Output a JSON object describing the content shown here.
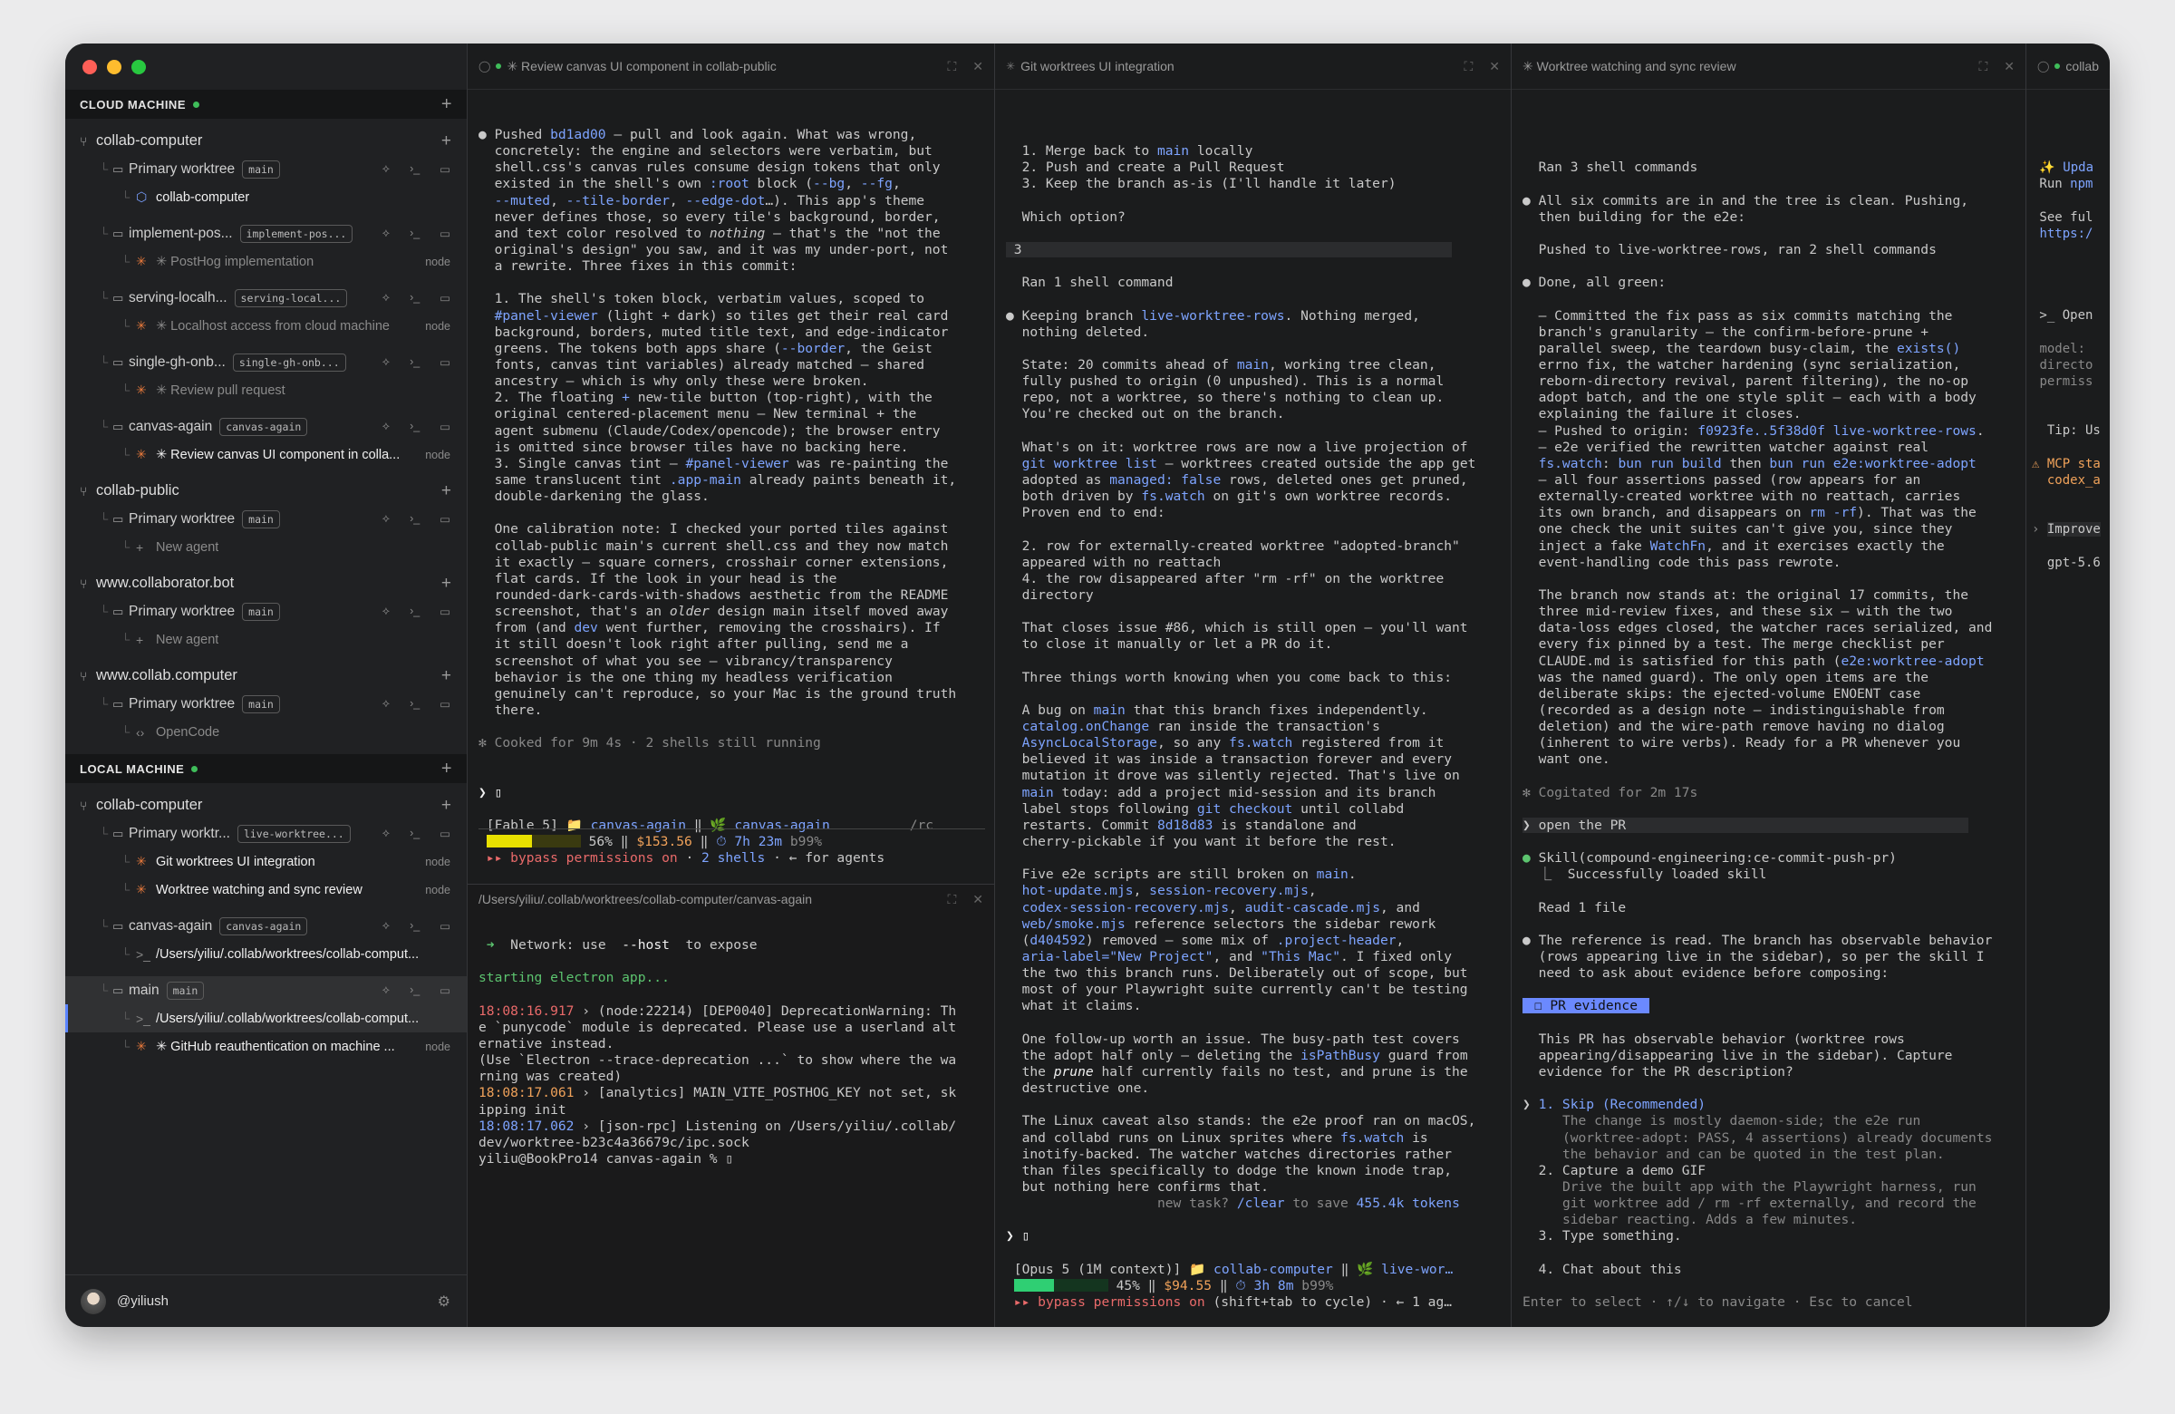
{
  "sidebar": {
    "cloud_header": "CLOUD MACHINE",
    "local_header": "LOCAL MACHINE",
    "user": "@yiliush",
    "cloud": [
      {
        "repo": "collab-computer",
        "worktrees": [
          {
            "name": "Primary worktree",
            "branch": "main",
            "items": [
              {
                "icon": "hex",
                "text": "collab-computer",
                "tone": "bright"
              }
            ]
          },
          {
            "name": "implement-pos...",
            "branch": "implement-pos...",
            "items": [
              {
                "icon": "star",
                "text": "✳ PostHog implementation",
                "tone": "dim",
                "node": "node"
              }
            ]
          },
          {
            "name": "serving-localh...",
            "branch": "serving-local...",
            "items": [
              {
                "icon": "star",
                "text": "✳ Localhost access from cloud machine",
                "tone": "dim",
                "node": "node"
              }
            ]
          },
          {
            "name": "single-gh-onb...",
            "branch": "single-gh-onb...",
            "items": [
              {
                "icon": "star",
                "text": "✳ Review pull request",
                "tone": "dim"
              }
            ]
          },
          {
            "name": "canvas-again",
            "branch": "canvas-again",
            "items": [
              {
                "icon": "star",
                "text": "✳ Review canvas UI component in colla...",
                "tone": "bright",
                "node": "node"
              }
            ]
          }
        ]
      },
      {
        "repo": "collab-public",
        "worktrees": [
          {
            "name": "Primary worktree",
            "branch": "main",
            "items": [
              {
                "icon": "plus",
                "text": "New agent",
                "tone": "dim"
              }
            ]
          }
        ]
      },
      {
        "repo": "www.collaborator.bot",
        "worktrees": [
          {
            "name": "Primary worktree",
            "branch": "main",
            "items": [
              {
                "icon": "plus",
                "text": "New agent",
                "tone": "dim"
              }
            ]
          }
        ]
      },
      {
        "repo": "www.collab.computer",
        "worktrees": [
          {
            "name": "Primary worktree",
            "branch": "main",
            "items": [
              {
                "icon": "code",
                "text": "OpenCode",
                "tone": "dim"
              }
            ]
          }
        ]
      }
    ],
    "local": [
      {
        "repo": "collab-computer",
        "worktrees": [
          {
            "name": "Primary worktr...",
            "branch": "live-worktree...",
            "items": [
              {
                "icon": "star",
                "text": "Git worktrees UI integration",
                "tone": "bright",
                "node": "node"
              },
              {
                "icon": "star",
                "text": "Worktree watching and sync review",
                "tone": "bright",
                "node": "node"
              }
            ]
          },
          {
            "name": "canvas-again",
            "branch": "canvas-again",
            "items": [
              {
                "icon": "term",
                "text": "/Users/yiliu/.collab/worktrees/collab-comput...",
                "tone": "bright"
              }
            ]
          },
          {
            "name": "main",
            "branch": "main",
            "active": true,
            "items": [
              {
                "icon": "term",
                "text": "/Users/yiliu/.collab/worktrees/collab-comput...",
                "tone": "bright",
                "active": true
              },
              {
                "icon": "star",
                "text": "✳ GitHub reauthentication on machine ...",
                "tone": "bright",
                "node": "node"
              }
            ]
          }
        ]
      }
    ]
  },
  "panes": {
    "p1": {
      "title": "✳ Review canvas UI component in collab-public",
      "lines": [
        "● Pushed <span class=\"hl\">bd1ad00</span> — pull and look again. What was wrong,",
        "  concretely: the engine and selectors were verbatim, but",
        "  shell.css's canvas rules consume design tokens that only",
        "  existed in the shell's own <span class=\"hl\">:root</span> block (<span class=\"hl\">--bg</span>, <span class=\"hl\">--fg</span>,",
        "  <span class=\"hl\">--muted</span>, <span class=\"hl\">--tile-border</span>, <span class=\"hl\">--edge-dot</span>…). This app's theme",
        "  never defines those, so every tile's background, border,",
        "  and text color resolved to <i>nothing</i> — that's the \"not the",
        "  original's design\" you saw, and it was my under-port, not",
        "  a rewrite. Three fixes in this commit:",
        "",
        "  1. The shell's token block, verbatim values, scoped to",
        "  <span class=\"hl\">#panel-viewer</span> (light + dark) so tiles get their real card",
        "  background, borders, muted title text, and edge-indicator",
        "  greens. The tokens both apps share (<span class=\"hl\">--border</span>, the Geist",
        "  fonts, canvas tint variables) already matched — shared",
        "  ancestry — which is why only these were broken.",
        "  2. The floating <span class=\"hl\">+</span> new-tile button (top-right), with the",
        "  original centered-placement menu — New terminal + the",
        "  agent submenu (Claude/Codex/opencode); the browser entry",
        "  is omitted since browser tiles have no backing here.",
        "  3. Single canvas tint — <span class=\"hl\">#panel-viewer</span> was re-painting the",
        "  same translucent tint <span class=\"hl\">.app-main</span> already paints beneath it,",
        "  double-darkening the glass.",
        "",
        "  One calibration note: I checked your ported tiles against",
        "  collab-public main's current shell.css and they now match",
        "  it exactly — square corners, crosshair corner extensions,",
        "  flat cards. If the look in your head is the",
        "  rounded-dark-cards-with-shadows aesthetic from the README",
        "  screenshot, that's an <i>older</i> design main itself moved away",
        "  from (and <span class=\"hl\">dev</span> went further, removing the crosshairs). If",
        "  it still doesn't look right after pulling, send me a",
        "  screenshot of what you see — vibrancy/transparency",
        "  behavior is the one thing my headless verification",
        "  genuinely can't reproduce, so your Mac is the ground truth",
        "  there.",
        "",
        "<span class=\"dim\">✻ Cooked for 9m 4s · 2 shells still running</span>",
        "",
        "",
        "<span class=\"wh\">❯ ▯</span>",
        "",
        " [Fable 5] 📁 <span class=\"hl\">canvas-again</span> ‖ 🌿 <span class=\"hl\">canvas-again</span>          <span class=\"dim\">/rc</span>",
        " <span class=\"bar\" style=\"width:50px;background:#e8e000\"></span><span class=\"bar\" style=\"width:54px;background:#3a3a10\"></span> 56% ‖ <span class=\"or\">$153.56</span> ‖ <span class=\"hl\">⏱ 7h 23m</span> <span class=\"dim\">b99%</span>",
        " <span class=\"rd\">▸▸ bypass permissions on</span> · <span class=\"hl\">2 shells</span> · ← for agents"
      ]
    },
    "p1term": {
      "title": "/Users/yiliu/.collab/worktrees/collab-computer/canvas-again",
      "lines": [
        "",
        " <span class=\"gr\">➜</span>  Network: use  <span class=\"wh\">--host</span>  to expose",
        "",
        "<span class=\"gr\">starting electron app...</span>",
        "",
        "<span class=\"rd\">18:08:16.917</span> › (node:22214) [DEP0040] DeprecationWarning: Th",
        "e `punycode` module is deprecated. Please use a userland alt",
        "ernative instead.",
        "(Use `Electron --trace-deprecation ...` to show where the wa",
        "rning was created)",
        "<span class=\"or\">18:08:17.061</span> › [analytics] MAIN_VITE_POSTHOG_KEY not set, sk",
        "ipping init",
        "<span class=\"hl\">18:08:17.062</span> › [json-rpc] Listening on /Users/yiliu/.collab/",
        "dev/worktree-b23c4a36679c/ipc.sock",
        "yiliu@BookPro14 canvas-again % ▯"
      ]
    },
    "p2": {
      "title": "Git worktrees UI integration",
      "lines": [
        "",
        "  1. Merge back to <span class=\"hl\">main</span> locally",
        "  2. Push and create a Pull Request",
        "  3. Keep the branch as-is (I'll handle it later)",
        "",
        "  Which option?",
        "",
        "<span class=\"choice\"> 3                                                      </span>",
        "",
        "  Ran 1 shell command",
        "",
        "● Keeping branch <span class=\"hl\">live-worktree-rows</span>. Nothing merged,",
        "  nothing deleted.",
        "",
        "  State: 20 commits ahead of <span class=\"hl\">main</span>, working tree clean,",
        "  fully pushed to origin (0 unpushed). This is a normal",
        "  repo, not a worktree, so there's nothing to clean up.",
        "  You're checked out on the branch.",
        "",
        "  What's on it: worktree rows are now a live projection of",
        "  <span class=\"hl\">git worktree list</span> — worktrees created outside the app get",
        "  adopted as <span class=\"hl\">managed: false</span> rows, deleted ones get pruned,",
        "  both driven by <span class=\"hl\">fs.watch</span> on git's own worktree records.",
        "  Proven end to end:",
        "",
        "  2. row for externally-created worktree \"adopted-branch\"",
        "  appeared with no reattach",
        "  4. the row disappeared after \"rm -rf\" on the worktree",
        "  directory",
        "",
        "  That closes issue #86, which is still open — you'll want",
        "  to close it manually or let a PR do it.",
        "",
        "  Three things worth knowing when you come back to this:",
        "",
        "  A bug on <span class=\"hl\">main</span> that this branch fixes independently.",
        "  <span class=\"hl\">catalog.onChange</span> ran inside the transaction's",
        "  <span class=\"hl\">AsyncLocalStorage</span>, so any <span class=\"hl\">fs.watch</span> registered from it",
        "  believed it was inside a transaction forever and every",
        "  mutation it drove was silently rejected. That's live on",
        "  <span class=\"hl\">main</span> today: add a project mid-session and its branch",
        "  label stops following <span class=\"hl\">git checkout</span> until collabd",
        "  restarts. Commit <span class=\"hl\">8d18d83</span> is standalone and",
        "  cherry-pickable if you want it before the rest.",
        "",
        "  Five e2e scripts are still broken on <span class=\"hl\">main</span>.",
        "  <span class=\"hl\">hot-update.mjs</span>, <span class=\"hl\">session-recovery.mjs</span>,",
        "  <span class=\"hl\">codex-session-recovery.mjs</span>, <span class=\"hl\">audit-cascade.mjs</span>, and",
        "  <span class=\"hl\">web/smoke.mjs</span> reference selectors the sidebar rework",
        "  (<span class=\"hl\">d404592</span>) removed — some mix of <span class=\"hl\">.project-header</span>,",
        "  <span class=\"hl\">aria-label=\"New Project\"</span>, and <span class=\"hl\">\"This Mac\"</span>. I fixed only",
        "  the two this branch runs. Deliberately out of scope, but",
        "  most of your Playwright suite currently can't be testing",
        "  what it claims.",
        "",
        "  One follow-up worth an issue. The busy-path test covers",
        "  the adopt half only — deleting the <span class=\"hl\">isPathBusy</span> guard from",
        "  the <i class=\"wh\">prune</i> half currently fails no test, and prune is the",
        "  destructive one.",
        "",
        "  The Linux caveat also stands: the e2e proof ran on macOS,",
        "  and collabd runs on Linux sprites where <span class=\"hl\">fs.watch</span> is",
        "  inotify-backed. The watcher watches directories rather",
        "  than files specifically to dodge the known inode trap,",
        "  but nothing here confirms that.",
        "                   <span class=\"dim\">new task?</span> <span class=\"hl\">/clear</span> <span class=\"dim\">to save</span> <span class=\"hl\">455.4k tokens</span>",
        "",
        "<span class=\"wh\">❯ ▯</span>",
        "",
        " [Opus 5 (1M context)] 📁 <span class=\"hl\">collab-computer</span> ‖ 🌿 <span class=\"hl\">live-wor…</span>",
        " <span class=\"bar\" style=\"width:44px;background:#2fcf73\"></span><span class=\"bar\" style=\"width:60px;background:#14351f\"></span> 45% ‖ <span class=\"or\">$94.55</span> ‖ <span class=\"hl\">⏱ 3h 8m</span> <span class=\"dim\">b99%</span>",
        " <span class=\"rd\">▸▸ bypass permissions on</span> (shift+tab to cycle) · ← 1 ag…"
      ]
    },
    "p3": {
      "title": "✳ Worktree watching and sync review",
      "lines": [
        "",
        "",
        "  Ran 3 shell commands",
        "",
        "● All six commits are in and the tree is clean. Pushing,",
        "  then building for the e2e:",
        "",
        "  Pushed to live-worktree-rows, ran 2 shell commands",
        "",
        "● Done, all green:",
        "",
        "  – Committed the fix pass as six commits matching the",
        "  branch's granularity — the confirm-before-prune +",
        "  parallel sweep, the teardown busy-claim, the <span class=\"hl\">exists()</span>",
        "  errno fix, the watcher hardening (sync serialization,",
        "  reborn-directory revival, parent filtering), the no-op",
        "  adopt batch, and the one style split — each with a body",
        "  explaining the failure it closes.",
        "  – Pushed to origin: <span class=\"hl\">f0923fe..5f38d0f live-worktree-rows</span>.",
        "  – e2e verified the rewritten watcher against real",
        "  <span class=\"hl\">fs.watch</span>: <span class=\"hl\">bun run build</span> then <span class=\"hl\">bun run e2e:worktree-adopt</span>",
        "  — all four assertions passed (row appears for an",
        "  externally-created worktree with no reattach, carries",
        "  its own branch, and disappears on <span class=\"hl\">rm -rf</span>). That was the",
        "  one check the unit suites can't give you, since they",
        "  inject a fake <span class=\"hl\">WatchFn</span>, and it exercises exactly the",
        "  event-handling code this pass rewrote.",
        "",
        "  The branch now stands at: the original 17 commits, the",
        "  three mid-review fixes, and these six — with the two",
        "  data-loss edges closed, the watcher races serialized, and",
        "  every fix pinned by a test. The merge checklist per",
        "  CLAUDE.md is satisfied for this path (<span class=\"hl\">e2e:worktree-adopt</span>",
        "  was the named guard). The only open items are the",
        "  deliberate skips: the ejected-volume ENOENT case",
        "  (recorded as a design note — indistinguishable from",
        "  deletion) and the wire-path remove having no dialog",
        "  (inherent to wire verbs). Ready for a PR whenever you",
        "  want one.",
        "",
        "<span class=\"dim\">✻ Cogitated for 2m 17s</span>",
        "",
        "<span class=\"choice\">❯ open the PR                                           </span>",
        "",
        "<span class=\"gr\">●</span> Skill(compound-engineering:ce-commit-push-pr)",
        "  ⎿  Successfully loaded skill",
        "",
        "  Read 1 file",
        "",
        "● The reference is read. The branch has observable behavior",
        "  (rows appearing live in the sidebar), so per the skill I",
        "  need to ask about evidence before composing:",
        "",
        "<span class=\"tag\"> ☐ PR evidence </span>",
        "",
        "  This PR has observable behavior (worktree rows",
        "  appearing/disappearing live in the sidebar). Capture",
        "  evidence for the PR description?",
        "",
        "❯ <span class=\"hl\">1. Skip (Recommended)</span>",
        "     <span class=\"dim\">The change is mostly daemon-side; the e2e run</span>",
        "     <span class=\"dim\">(worktree-adopt: PASS, 4 assertions) already documents</span>",
        "     <span class=\"dim\">the behavior and can be quoted in the test plan.</span>",
        "  2. Capture a demo GIF",
        "     <span class=\"dim\">Drive the built app with the Playwright harness, run</span>",
        "     <span class=\"dim\">git worktree add / rm -rf externally, and record the</span>",
        "     <span class=\"dim\">sidebar reacting. Adds a few minutes.</span>",
        "  3. Type something.",
        "",
        "  4. Chat about this",
        "",
        "<span class=\"dim\">Enter to select · ↑/↓ to navigate · Esc to cancel</span>"
      ]
    },
    "p4": {
      "title": "collab",
      "lines": [
        "",
        " ✨ <span class=\"hl\">Upda</span>",
        " Run <span class=\"hl\">npm</span>",
        "",
        " See ful",
        " <span class=\"hl\">https:/</span>",
        "",
        "",
        "",
        "",
        " >_ Open",
        "",
        " <span class=\"dim\">model:</span>",
        " <span class=\"dim\">directo</span>",
        " <span class=\"dim\">permiss</span>",
        "",
        "",
        "  Tip: Us",
        "",
        "<span class=\"or\">⚠ MCP sta</span>",
        "  <span class=\"or\">codex_a</span>",
        "",
        "",
        "<span class=\"dim\">› </span><span class=\"choice\">Improve</span>",
        "",
        "  gpt-5.6"
      ]
    }
  }
}
